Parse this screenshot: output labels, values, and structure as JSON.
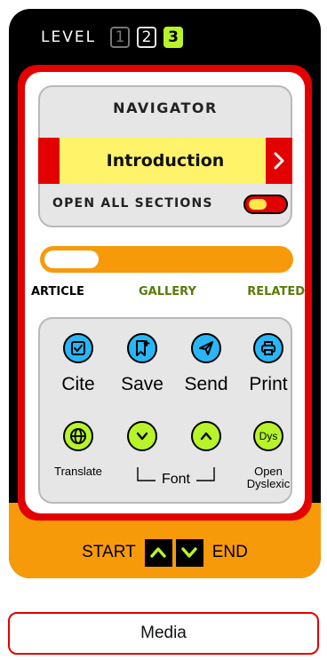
{
  "level": {
    "label": "LEVEL",
    "options": [
      "1",
      "2",
      "3"
    ],
    "active": "3"
  },
  "navigator": {
    "title": "NAVIGATOR",
    "section": "Introduction",
    "open_all_label": "OPEN ALL SECTIONS",
    "open_all_on": true
  },
  "progress": {
    "fraction": 0.22
  },
  "tabs": {
    "article": "ARTICLE",
    "gallery": "GALLERY",
    "related": "RELATED",
    "active": "ARTICLE"
  },
  "actions": {
    "cite": "Cite",
    "save": "Save",
    "send": "Send",
    "print": "Print",
    "translate": "Translate",
    "font": "Font",
    "dys_icon_text": "Dys",
    "open_dyslexic_line1": "Open",
    "open_dyslexic_line2": "Dyslexic"
  },
  "bottom_nav": {
    "start": "START",
    "end": "END"
  },
  "media_button": "Media",
  "colors": {
    "red": "#e30000",
    "orange": "#f79a0a",
    "yellow": "#fff36a",
    "lime": "#b7f42a",
    "blue": "#28b6f6"
  }
}
